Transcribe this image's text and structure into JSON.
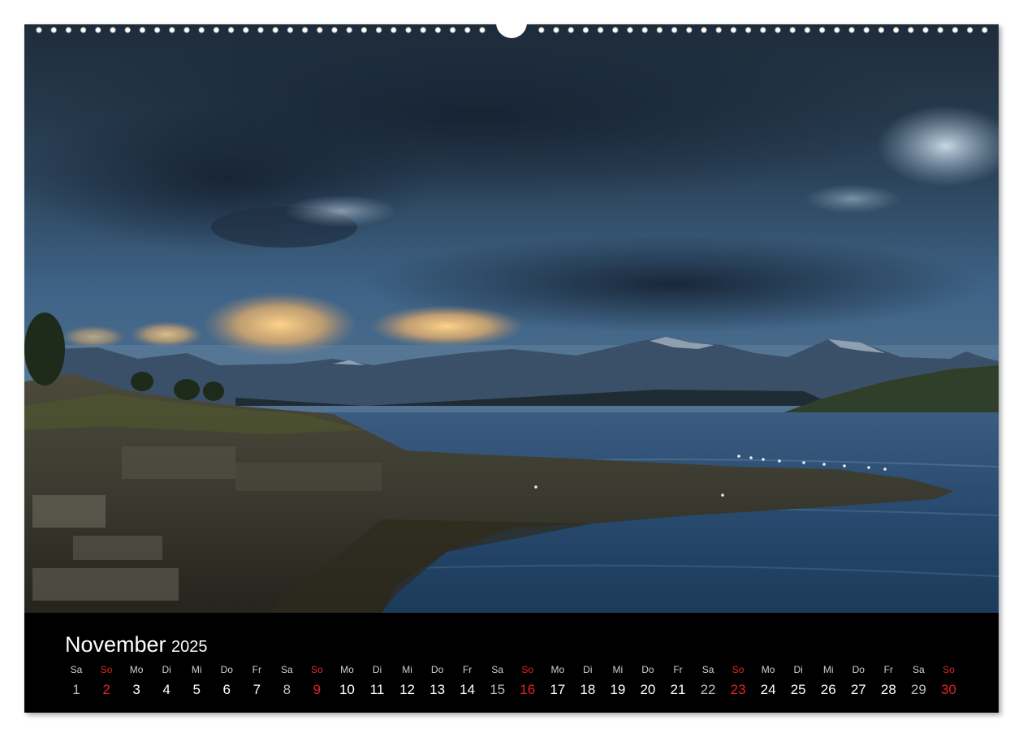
{
  "calendar": {
    "month": "November",
    "year": "2025",
    "colors": {
      "sunday": "#e02424",
      "saturday": "#bdbdbd",
      "weekday": "#ffffff",
      "background": "#000000"
    },
    "days": [
      {
        "wd": "Sa",
        "d": "1",
        "type": "sat"
      },
      {
        "wd": "So",
        "d": "2",
        "type": "sun"
      },
      {
        "wd": "Mo",
        "d": "3",
        "type": "day"
      },
      {
        "wd": "Di",
        "d": "4",
        "type": "day"
      },
      {
        "wd": "Mi",
        "d": "5",
        "type": "day"
      },
      {
        "wd": "Do",
        "d": "6",
        "type": "day"
      },
      {
        "wd": "Fr",
        "d": "7",
        "type": "day"
      },
      {
        "wd": "Sa",
        "d": "8",
        "type": "sat"
      },
      {
        "wd": "So",
        "d": "9",
        "type": "sun"
      },
      {
        "wd": "Mo",
        "d": "10",
        "type": "day"
      },
      {
        "wd": "Di",
        "d": "11",
        "type": "day"
      },
      {
        "wd": "Mi",
        "d": "12",
        "type": "day"
      },
      {
        "wd": "Do",
        "d": "13",
        "type": "day"
      },
      {
        "wd": "Fr",
        "d": "14",
        "type": "day"
      },
      {
        "wd": "Sa",
        "d": "15",
        "type": "sat"
      },
      {
        "wd": "So",
        "d": "16",
        "type": "sun"
      },
      {
        "wd": "Mo",
        "d": "17",
        "type": "day"
      },
      {
        "wd": "Di",
        "d": "18",
        "type": "day"
      },
      {
        "wd": "Mi",
        "d": "19",
        "type": "day"
      },
      {
        "wd": "Do",
        "d": "20",
        "type": "day"
      },
      {
        "wd": "Fr",
        "d": "21",
        "type": "day"
      },
      {
        "wd": "Sa",
        "d": "22",
        "type": "sat"
      },
      {
        "wd": "So",
        "d": "23",
        "type": "sun"
      },
      {
        "wd": "Mo",
        "d": "24",
        "type": "day"
      },
      {
        "wd": "Di",
        "d": "25",
        "type": "day"
      },
      {
        "wd": "Mi",
        "d": "26",
        "type": "day"
      },
      {
        "wd": "Do",
        "d": "27",
        "type": "day"
      },
      {
        "wd": "Fr",
        "d": "28",
        "type": "day"
      },
      {
        "wd": "Sa",
        "d": "29",
        "type": "sat"
      },
      {
        "wd": "So",
        "d": "30",
        "type": "sun"
      }
    ]
  }
}
